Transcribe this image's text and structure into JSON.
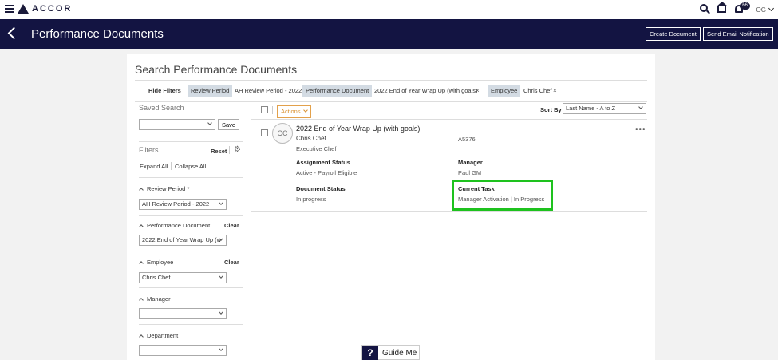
{
  "topbar": {
    "brand": "ACCOR",
    "notifications_count": "66",
    "user_initials": "OG"
  },
  "header": {
    "title": "Performance Documents",
    "create_button": "Create Document",
    "notify_button": "Send Email Notification"
  },
  "panel": {
    "title": "Search Performance Documents",
    "hide_filters": "Hide Filters",
    "chips": [
      {
        "key": "Review Period",
        "value": "AH Review Period - 2022"
      },
      {
        "key": "Performance Document",
        "value": "2022 End of Year Wrap Up (with goals)"
      },
      {
        "key": "Employee",
        "value": "Chris Chef"
      }
    ],
    "chip_close": "×"
  },
  "sidebar": {
    "saved_search_label": "Saved Search",
    "save_button": "Save",
    "filters_label": "Filters",
    "reset": "Reset",
    "expand_all": "Expand All",
    "collapse_all": "Collapse All",
    "clear": "Clear",
    "groups": [
      {
        "label": "Review Period *",
        "value": "AH Review Period - 2022"
      },
      {
        "label": "Performance Document",
        "value": "2022 End of Year Wrap Up (w"
      },
      {
        "label": "Employee",
        "value": "Chris Chef"
      },
      {
        "label": "Manager",
        "value": ""
      },
      {
        "label": "Department",
        "value": ""
      }
    ]
  },
  "results": {
    "actions_label": "Actions",
    "sort_by_label": "Sort By",
    "sort_value": "Last Name - A to Z",
    "item": {
      "initials": "CC",
      "title": "2022 End of Year Wrap Up (with goals)",
      "employee": "Chris Chef",
      "employee_id": "A5376",
      "job_title": "Executive Chef",
      "assignment_status_label": "Assignment Status",
      "assignment_status": "Active - Payroll Eligible",
      "manager_label": "Manager",
      "manager": "Paul GM",
      "document_status_label": "Document Status",
      "document_status": "In progress",
      "current_task_label": "Current Task",
      "current_task": "Manager Activation | In Progress",
      "more": "•••"
    }
  },
  "guide": {
    "icon": "?",
    "label": "Guide Me"
  },
  "colors": {
    "header_bg": "#131442",
    "highlight": "#1ec21e",
    "actions_accent": "#e3a14b"
  }
}
